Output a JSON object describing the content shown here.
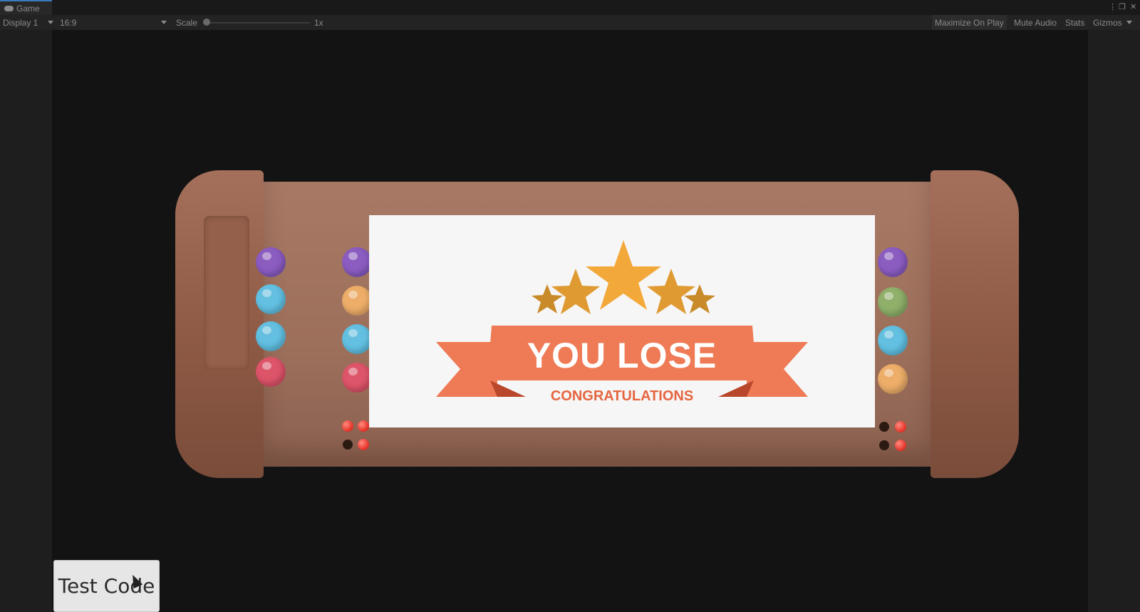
{
  "window": {
    "tab_label": "Game",
    "menu_icon": "kebab-menu-icon",
    "restore_icon": "restore-window-icon",
    "close_icon": "close-icon"
  },
  "toolbar": {
    "display": "Display 1",
    "aspect": "16:9",
    "scale_label": "Scale",
    "scale_value": "1x",
    "scale_level": 0.0,
    "maximize_on_play": "Maximize On Play",
    "mute_audio": "Mute Audio",
    "stats": "Stats",
    "gizmos": "Gizmos"
  },
  "game": {
    "banner_title": "YOU LOSE",
    "banner_subtitle": "CONGRATULATIONS",
    "stars_count": 5,
    "left_panel_gems": [
      "#8b5cc4",
      "#62c3e6",
      "#62c3e6",
      "#e0546a"
    ],
    "left_column_gems": [
      "#8b5cc4",
      "#f0b06a",
      "#62c3e6",
      "#e0546a"
    ],
    "right_column_gems": [
      "#8b5cc4",
      "#8fb26b",
      "#62c3e6",
      "#f0b06a"
    ],
    "colors": {
      "console": "#9c6f5b",
      "banner": "#ef7b56",
      "banner_dark": "#d25a3a",
      "star": "#f3a83a",
      "star_dark": "#c98a2a"
    }
  },
  "button": {
    "label": "Test Code"
  }
}
